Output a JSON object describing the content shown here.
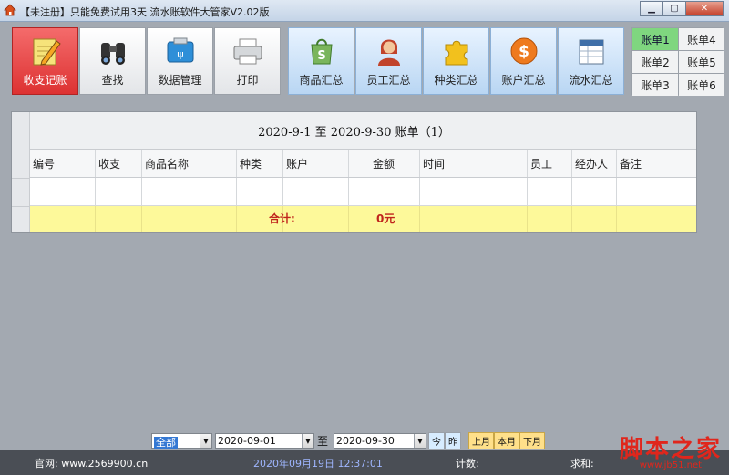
{
  "window": {
    "title": "【未注册】只能免费试用3天 流水账软件大管家V2.02版",
    "controls": [
      "minimize",
      "maximize",
      "close"
    ]
  },
  "toolbar": {
    "left_tools": [
      {
        "label": "收支记账",
        "icon": "pencil-notepad-icon"
      },
      {
        "label": "查找",
        "icon": "binoculars-icon"
      },
      {
        "label": "数据管理",
        "icon": "usb-drive-icon"
      },
      {
        "label": "打印",
        "icon": "printer-icon"
      }
    ],
    "summary_tools": [
      {
        "label": "商品汇总",
        "icon": "shopping-bag-icon"
      },
      {
        "label": "员工汇总",
        "icon": "person-icon"
      },
      {
        "label": "种类汇总",
        "icon": "puzzle-icon"
      },
      {
        "label": "账户汇总",
        "icon": "dollar-coin-icon"
      },
      {
        "label": "流水汇总",
        "icon": "ledger-icon"
      }
    ],
    "accounts": [
      "账单1",
      "账单4",
      "账单2",
      "账单5",
      "账单3",
      "账单6"
    ],
    "active_account": "账单1",
    "active_tool": "收支记账"
  },
  "table": {
    "caption": "2020-9-1  至  2020-9-30  账单（1）",
    "columns": [
      "编号",
      "收支",
      "商品名称",
      "种类",
      "账户",
      "金额",
      "时间",
      "员工",
      "经办人",
      "备注"
    ],
    "rows": [],
    "total_label": "合计:",
    "total_value": "0元"
  },
  "filter": {
    "scope": "全部",
    "start_date": "2020-09-01",
    "to_label": "至",
    "end_date": "2020-09-30",
    "btn_today": "今",
    "btn_yesterday": "昨",
    "btn_last_month": "上月",
    "btn_this_month": "本月",
    "btn_next_month": "下月"
  },
  "statusbar": {
    "site": "官网: www.2569900.cn",
    "datetime": "2020年09月19日  12:37:01",
    "count_label": "计数:",
    "sum_label": "求和:"
  },
  "watermark": {
    "big": "脚本之家",
    "small": "www.jb51.net"
  },
  "colors": {
    "active_tool": "#e23c3c",
    "summary_tool": "#cfe4fb",
    "active_account": "#7fd67f",
    "total_row": "#fdf99a",
    "total_text": "#c0241c",
    "statusbar": "#4a4e55"
  }
}
